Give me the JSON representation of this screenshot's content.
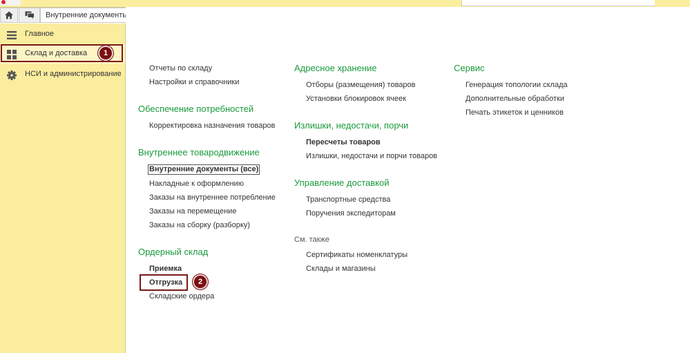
{
  "tabs": {
    "doc_tab_label": "Внутренние документы ("
  },
  "sidebar": {
    "items": [
      {
        "label": "Главное",
        "icon": "menu-lines-icon"
      },
      {
        "label": "Склад и доставка",
        "icon": "grid-icon"
      },
      {
        "label": "НСИ и администрирование",
        "icon": "gear-icon"
      }
    ]
  },
  "callouts": {
    "first": "1",
    "second": "2"
  },
  "main": {
    "col1": {
      "top_links": [
        "Отчеты по складу",
        "Настройки и справочники"
      ],
      "sections": [
        {
          "title": "Обеспечение потребностей",
          "links": [
            "Корректировка назначения товаров"
          ]
        },
        {
          "title": "Внутреннее товародвижение",
          "links": [
            "Внутренние документы (все)",
            "Накладные к оформлению",
            "Заказы на внутреннее потребление",
            "Заказы на перемещение",
            "Заказы на сборку (разборку)"
          ]
        },
        {
          "title": "Ордерный склад",
          "links": [
            "Приемка",
            "Отгрузка",
            "Складские ордера"
          ]
        }
      ]
    },
    "col2": {
      "sections": [
        {
          "title": "Адресное хранение",
          "links": [
            "Отборы (размещения) товаров",
            "Установки блокировок ячеек"
          ]
        },
        {
          "title": "Излишки, недостачи, порчи",
          "links": [
            "Пересчеты товаров",
            "Излишки, недостачи и порчи товаров"
          ]
        },
        {
          "title": "Управление доставкой",
          "links": [
            "Транспортные средства",
            "Поручения экспедиторам"
          ]
        }
      ],
      "see_also": {
        "title": "См. также",
        "links": [
          "Сертификаты номенклатуры",
          "Склады и магазины"
        ]
      }
    },
    "col3": {
      "sections": [
        {
          "title": "Сервис",
          "links": [
            "Генерация топологии склада",
            "Дополнительные обработки",
            "Печать этикеток и ценников"
          ]
        }
      ]
    }
  },
  "colors": {
    "accent_green": "#1a9a3c",
    "sidebar_bg": "#fbed9e",
    "callout": "#7a1010"
  }
}
